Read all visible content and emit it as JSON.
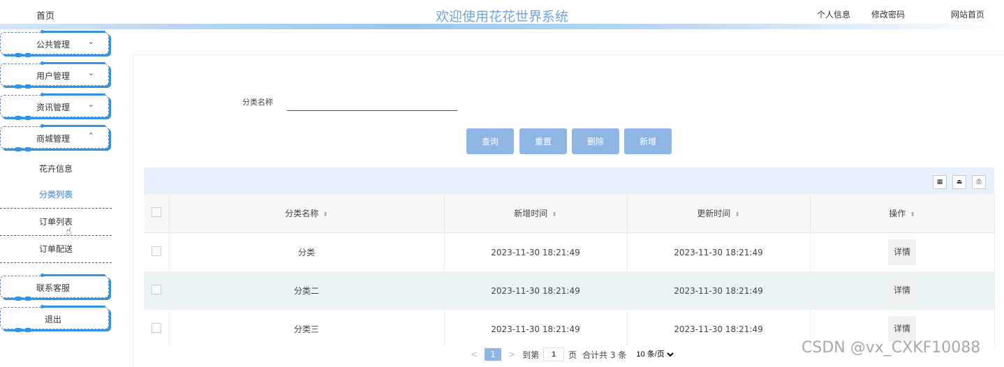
{
  "header": {
    "home_label": "首页",
    "title": "欢迎使用花花世界系统",
    "personal_info": "个人信息",
    "change_password": "修改密码",
    "site_home": "网站首页"
  },
  "sidebar": {
    "menus": [
      {
        "label": "公共管理",
        "chevron": "⌄"
      },
      {
        "label": "用户管理",
        "chevron": "⌄"
      },
      {
        "label": "资讯管理",
        "chevron": "⌄"
      },
      {
        "label": "商城管理",
        "chevron": "⌃"
      }
    ],
    "submenu": [
      {
        "label": "花卉信息"
      },
      {
        "label": "分类列表",
        "active": true
      },
      {
        "label": "订单列表"
      },
      {
        "label": "订单配送"
      }
    ],
    "contact": "联系客服",
    "logout": "退出"
  },
  "search": {
    "label": "分类名称",
    "value": ""
  },
  "buttons": {
    "query": "查询",
    "reset": "重置",
    "delete": "删除",
    "add": "新增"
  },
  "table": {
    "headers": [
      "分类名称",
      "新增时间",
      "更新时间",
      "操作"
    ],
    "rows": [
      {
        "name": "分类",
        "created": "2023-11-30 18:21:49",
        "updated": "2023-11-30 18:21:49",
        "action": "详情"
      },
      {
        "name": "分类二",
        "created": "2023-11-30 18:21:49",
        "updated": "2023-11-30 18:21:49",
        "action": "详情"
      },
      {
        "name": "分类三",
        "created": "2023-11-30 18:21:49",
        "updated": "2023-11-30 18:21:49",
        "action": "详情"
      }
    ]
  },
  "pagination": {
    "prev": "<",
    "current": "1",
    "next": ">",
    "goto_label": "到第",
    "goto_value": "1",
    "page_unit": "页",
    "total": "合计共 3 条",
    "page_size": "10 条/页"
  },
  "watermark": "CSDN @vx_CXKF10088"
}
